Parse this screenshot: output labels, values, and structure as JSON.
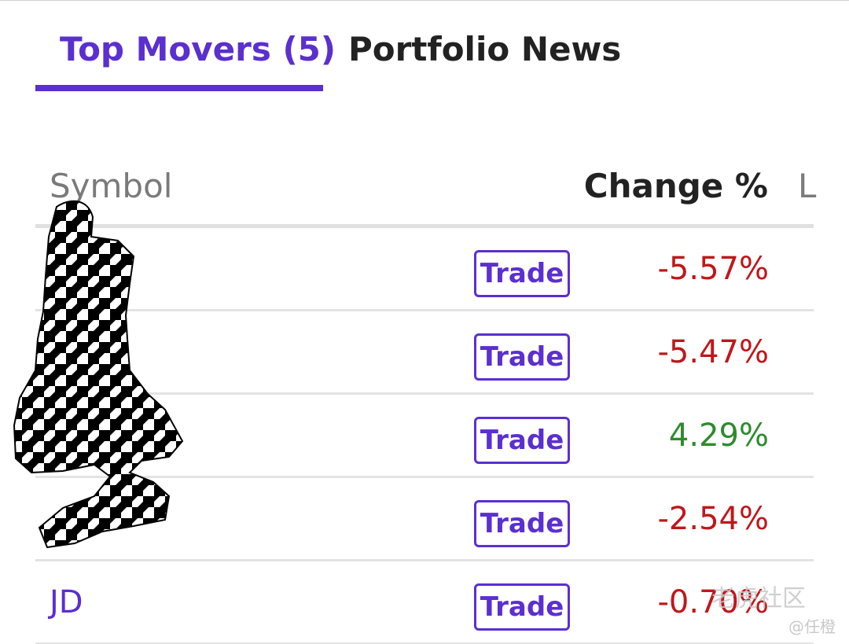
{
  "tabs": [
    {
      "label": "Top Movers (5)",
      "active": true
    },
    {
      "label": "Portfolio News",
      "active": false
    }
  ],
  "table": {
    "headers": {
      "symbol": "Symbol",
      "change": "Change %",
      "last": "L"
    },
    "rows": [
      {
        "symbol": "",
        "trade": "Trade",
        "change": "-5.57%",
        "direction": "down"
      },
      {
        "symbol": "",
        "trade": "Trade",
        "change": "-5.47%",
        "direction": "down"
      },
      {
        "symbol": "",
        "trade": "Trade",
        "change": "4.29%",
        "direction": "up"
      },
      {
        "symbol": "",
        "trade": "Trade",
        "change": "-2.54%",
        "direction": "down"
      },
      {
        "symbol": "JD",
        "trade": "Trade",
        "change": "-0.70%",
        "direction": "down"
      }
    ]
  },
  "watermark": {
    "brand": "老虎社区",
    "user": "@任橙"
  },
  "colors": {
    "accent": "#5b2fd0",
    "negative": "#c0171b",
    "positive": "#2e8b2e",
    "text": "#222222",
    "muted": "#7a7a7a"
  }
}
